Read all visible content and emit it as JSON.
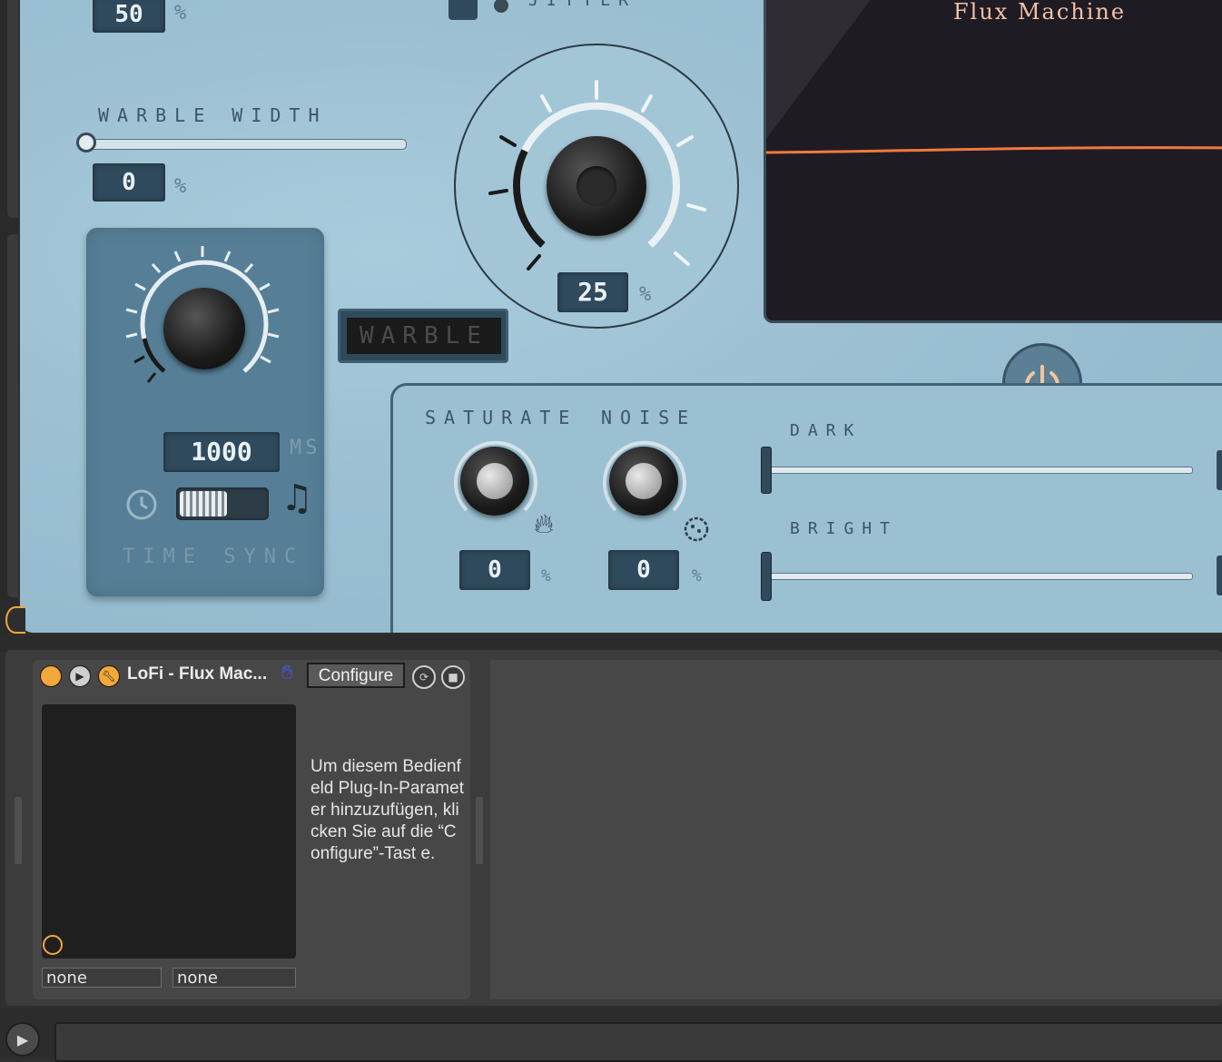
{
  "plugin": {
    "top_value": "50",
    "top_unit": "%",
    "jitter_label": "JITTER",
    "warble_width": {
      "label": "WARBLE WIDTH",
      "value": "0",
      "unit": "%",
      "level": 0
    },
    "jitter_knob": {
      "value": "25",
      "unit": "%"
    },
    "warble_button": "WARBLE",
    "time_sync": {
      "value": "1000",
      "unit": "MS",
      "label": "TIME SYNC"
    },
    "saturate": {
      "label": "SATURATE",
      "value": "0",
      "unit": "%"
    },
    "noise": {
      "label": "NOISE",
      "value": "0",
      "unit": "%"
    },
    "dark": {
      "label": "DARK"
    },
    "bright": {
      "label": "BRIGHT"
    },
    "display_title": "Flux Machine",
    "colors": {
      "accent": "#f07a3c",
      "panel": "#9dc1d3",
      "lcd": "#2f4a5c"
    }
  },
  "device": {
    "title": "LoFi - Flux Mac...",
    "configure_label": "Configure",
    "info_text": "Um diesem Bedienfeld Plug-In-Paramet er hinzuzufügen, klicken Sie auf die “Configure”-Tast e.",
    "param_a": "none",
    "param_b": "none"
  }
}
